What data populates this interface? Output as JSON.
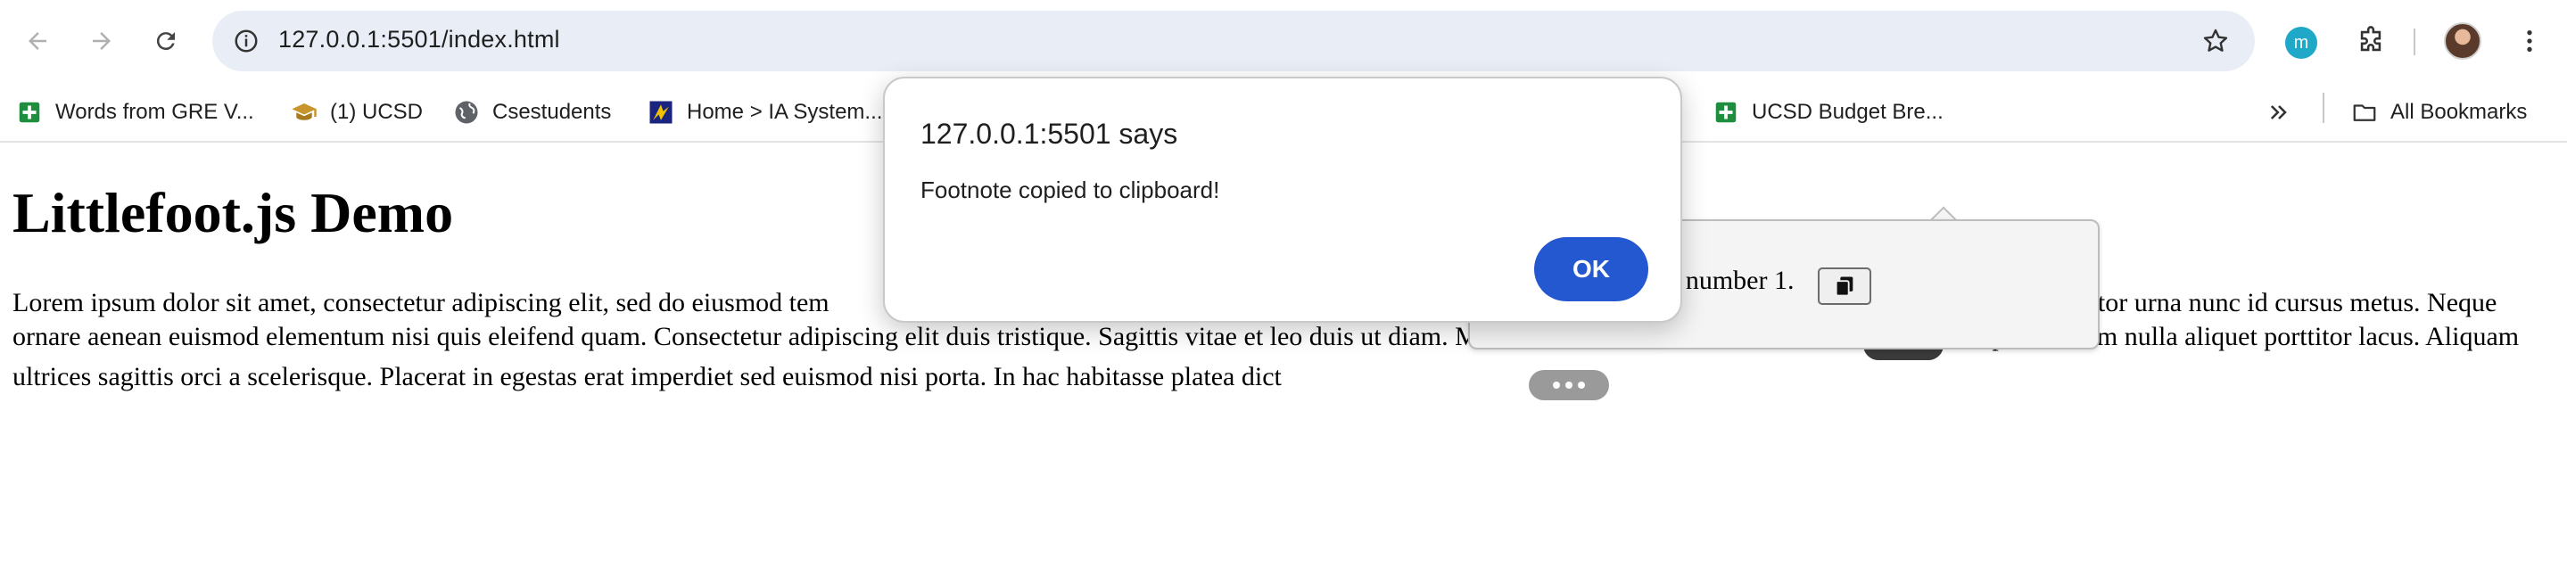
{
  "browser": {
    "url": "127.0.0.1:5501/index.html",
    "extension_badge": "m",
    "bookmarks": [
      {
        "label": "Words from GRE V...",
        "icon": "sheets-icon",
        "color": "#1e8e3e"
      },
      {
        "label": "(1) UCSD",
        "icon": "graduation-cap-icon",
        "color": "#c8952c"
      },
      {
        "label": "Csestudents",
        "icon": "globe-icon",
        "color": "#5f6368"
      },
      {
        "label": "Home > IA System...",
        "icon": "ia-logo-icon",
        "color": "#1a237e"
      },
      {
        "label": "UCSD Budget Bre...",
        "icon": "sheets-icon",
        "color": "#1e8e3e"
      }
    ],
    "all_bookmarks_label": "All Bookmarks"
  },
  "page": {
    "heading": "Littlefoot.js Demo",
    "text_part1": "Lorem ipsum dolor sit amet, consectetur adipiscing elit, sed do eiusmod tem",
    "text_part2": "n tincidunt dui. Tortor at auctor urna nunc id cursus metus. Neque ornare aenean euismod elementum nisi quis eleifend quam. Consectetur adipiscing elit duis tristique. Sagittis vitae et leo duis ut diam. Morbi blandit cursus risus at ultrices.",
    "text_part3": "Vulputate enim nulla aliquet porttitor lacus. Aliquam ultrices sagittis orci a scelerisque. Placerat in egestas erat imperdiet sed euismod nisi porta. In hac habitasse platea dict",
    "footnote_popover_text": "This is footnote number 1."
  },
  "dialog": {
    "title": "127.0.0.1:5501 says",
    "message": "Footnote copied to clipboard!",
    "ok_label": "OK"
  },
  "colors": {
    "accent": "#2458d0",
    "omnibox": "#e9eef6",
    "footnote_active": "#3a3a3a",
    "footnote_inactive": "#9a9a9a"
  }
}
